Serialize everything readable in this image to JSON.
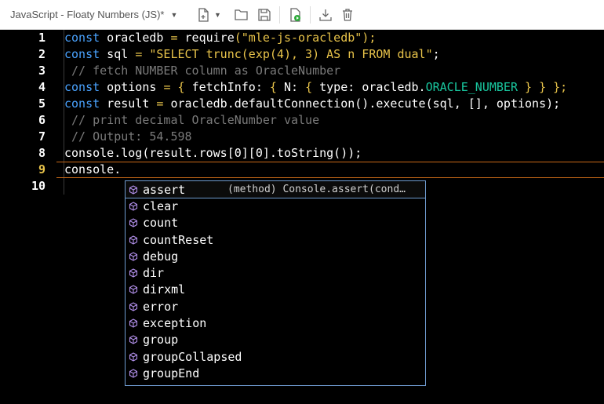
{
  "toolbar": {
    "file_title": "JavaScript - Floaty Numbers (JS)*"
  },
  "editor": {
    "line_numbers": [
      "1",
      "2",
      "3",
      "4",
      "5",
      "6",
      "7",
      "8",
      "9",
      "10"
    ],
    "lines": {
      "l1": {
        "kw": "const",
        "id": " oracledb ",
        "eq": "=",
        "fn": " require",
        "p1": "(",
        "str": "\"mle-js-oracledb\"",
        "p2": ");"
      },
      "l2": {
        "kw": "const",
        "id": " sql ",
        "eq": "=",
        "str": " \"SELECT trunc(exp(4), 3) AS n FROM dual\"",
        "end": ";"
      },
      "l3": {
        "comment": " // fetch NUMBER column as OracleNumber"
      },
      "l4": {
        "kw": "const",
        "id": " options ",
        "eq": "=",
        "b1": " { ",
        "key": "fetchInfo",
        "colon": ": ",
        "b2": "{ ",
        "key2": "N",
        "colon2": ": ",
        "b3": "{ ",
        "key3": "type",
        "colon3": ": ",
        "obj": "oracledb.",
        "const": "ORACLE_NUMBER",
        "b4": " } } };"
      },
      "l5": {
        "kw": "const",
        "id": " result ",
        "eq": "=",
        "rest": " oracledb.defaultConnection().execute(sql, [], options);"
      },
      "l6": {
        "comment": " // print decimal OracleNumber value"
      },
      "l7": {
        "comment": " // Output: 54.598"
      },
      "l8": {
        "text": "console.log(result.rows[0][0].toString());"
      },
      "l9": {
        "text": "console."
      },
      "l10": {
        "text": ""
      }
    }
  },
  "suggest": {
    "selected_detail": "(method) Console.assert(cond…",
    "items": [
      "assert",
      "clear",
      "count",
      "countReset",
      "debug",
      "dir",
      "dirxml",
      "error",
      "exception",
      "group",
      "groupCollapsed",
      "groupEnd"
    ]
  }
}
